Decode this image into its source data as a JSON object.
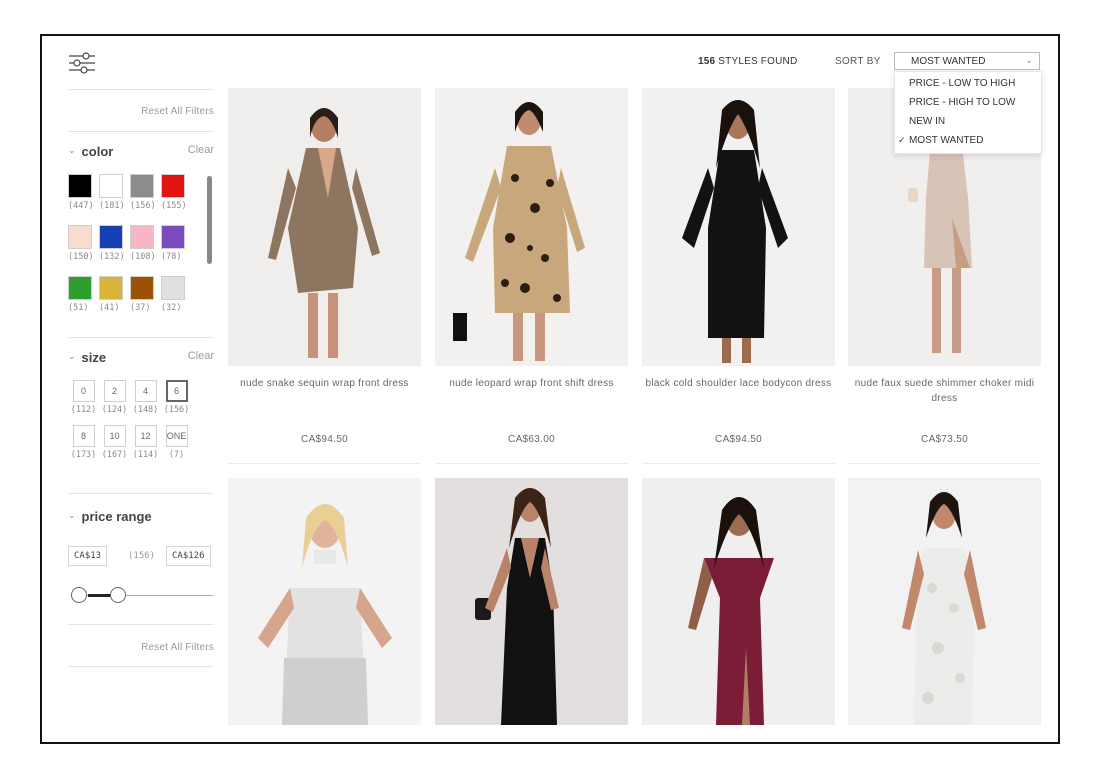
{
  "sidebar": {
    "reset_label": "Reset All Filters",
    "color": {
      "title": "color",
      "clear": "Clear",
      "swatches": [
        {
          "name": "black",
          "hex": "#000000",
          "count": "(447)"
        },
        {
          "name": "white",
          "hex": "#ffffff",
          "count": "(181)"
        },
        {
          "name": "grey",
          "hex": "#8c8c8c",
          "count": "(156)"
        },
        {
          "name": "red",
          "hex": "#e11414",
          "count": "(155)"
        },
        {
          "name": "nude",
          "hex": "#f8dcd0",
          "count": "(150)"
        },
        {
          "name": "blue",
          "hex": "#1640b3",
          "count": "(132)"
        },
        {
          "name": "pink",
          "hex": "#f7b6c3",
          "count": "(108)"
        },
        {
          "name": "purple",
          "hex": "#7a4bbd",
          "count": "(78)"
        },
        {
          "name": "green",
          "hex": "#2e9e2e",
          "count": "(51)"
        },
        {
          "name": "gold",
          "hex": "#d8b43d",
          "count": "(41)"
        },
        {
          "name": "brown",
          "hex": "#9b5207",
          "count": "(37)"
        },
        {
          "name": "silver",
          "hex": "#e0e0e0",
          "count": "(32)"
        }
      ]
    },
    "size": {
      "title": "size",
      "clear": "Clear",
      "options": [
        {
          "label": "0",
          "count": "(112)",
          "selected": false
        },
        {
          "label": "2",
          "count": "(124)",
          "selected": false
        },
        {
          "label": "4",
          "count": "(148)",
          "selected": false
        },
        {
          "label": "6",
          "count": "(156)",
          "selected": true
        },
        {
          "label": "8",
          "count": "(173)",
          "selected": false
        },
        {
          "label": "10",
          "count": "(167)",
          "selected": false
        },
        {
          "label": "12",
          "count": "(114)",
          "selected": false
        },
        {
          "label": "ONE",
          "count": "(7)",
          "selected": false
        }
      ]
    },
    "price": {
      "title": "price range",
      "min": "CA$13",
      "max": "CA$126",
      "count": "(156)"
    }
  },
  "header": {
    "count_num": "156",
    "count_text": "STYLES FOUND",
    "sort_label": "SORT BY",
    "sort_value": "MOST WANTED",
    "sort_options": [
      {
        "label": "PRICE - LOW TO HIGH",
        "checked": false
      },
      {
        "label": "PRICE - HIGH TO LOW",
        "checked": false
      },
      {
        "label": "NEW IN",
        "checked": false
      },
      {
        "label": "MOST WANTED",
        "checked": true
      }
    ]
  },
  "products": [
    {
      "name": "nude snake sequin wrap front dress",
      "price": "CA$94.50"
    },
    {
      "name": "nude leopard wrap front shift dress",
      "price": "CA$63.00"
    },
    {
      "name": "black cold shoulder lace bodycon dress",
      "price": "CA$94.50"
    },
    {
      "name": "nude faux suede shimmer choker midi dress",
      "price": "CA$73.50"
    },
    {
      "name": "",
      "price": ""
    },
    {
      "name": "",
      "price": ""
    },
    {
      "name": "",
      "price": ""
    },
    {
      "name": "",
      "price": ""
    }
  ],
  "colors": {
    "page_bg": "#ffffff",
    "frame_border": "#111111",
    "text_muted": "#9a9a9a",
    "product_bg": "#efefef"
  }
}
